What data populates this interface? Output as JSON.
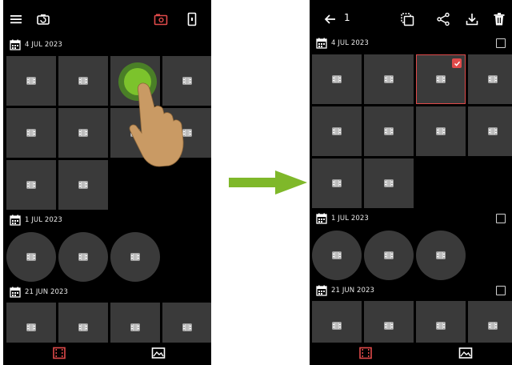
{
  "left": {
    "sections": [
      {
        "date": "4 JUL 2023"
      },
      {
        "date": "1 JUL 2023"
      },
      {
        "date": "21 JUN 2023"
      }
    ]
  },
  "right": {
    "selected_count": "1",
    "sections": [
      {
        "date": "4 JUL 2023"
      },
      {
        "date": "1 JUL 2023"
      },
      {
        "date": "21 JUN 2023"
      }
    ]
  },
  "colors": {
    "accent": "#e04a4a",
    "tile": "#3a3a3a",
    "background": "#000000",
    "arrow": "#7fb82a",
    "tap_indicator": "#6ab62a"
  },
  "icons": [
    "menu-icon",
    "switch-camera-icon",
    "camera-red-icon",
    "phone-icon",
    "back-arrow-icon",
    "select-all-icon",
    "share-icon",
    "download-icon",
    "delete-icon",
    "video-tab-icon",
    "photo-tab-icon"
  ]
}
